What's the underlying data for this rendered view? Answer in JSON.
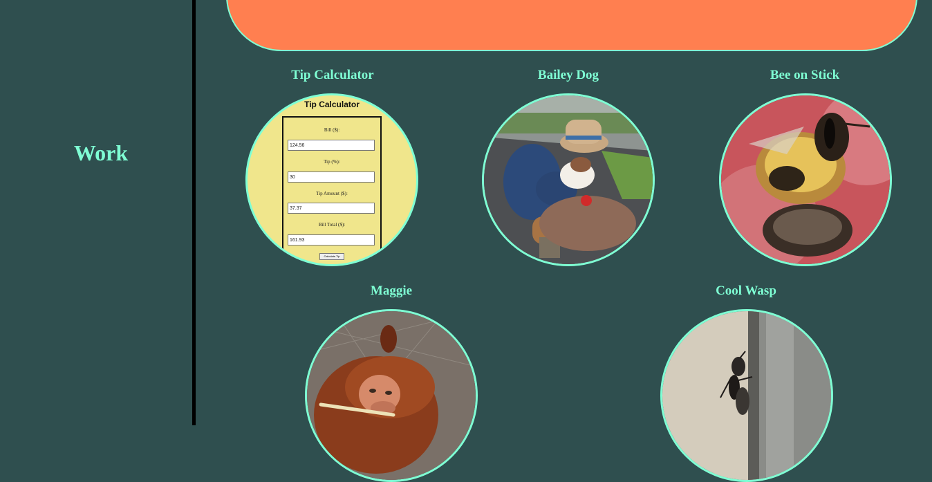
{
  "sidebar": {
    "title": "Work"
  },
  "colors": {
    "background": "#2f4f4f",
    "accent": "#7fffd4",
    "banner": "#ff7f50",
    "divider": "#000000"
  },
  "projects": [
    {
      "title": "Tip Calculator",
      "image": "tip-calculator-screenshot"
    },
    {
      "title": "Bailey Dog",
      "image": "person-hugging-dog-photo"
    },
    {
      "title": "Bee on Stick",
      "image": "bee-macro-photo"
    },
    {
      "title": "Maggie",
      "image": "orangutan-photo"
    },
    {
      "title": "Cool Wasp",
      "image": "wasp-on-post-photo"
    }
  ],
  "tip_calc": {
    "heading": "Tip Calculator",
    "bill_label": "Bill ($):",
    "bill_value": "124.56",
    "tip_label": "Tip (%):",
    "tip_value": "30",
    "amount_label": "Tip Amount ($):",
    "amount_value": "37.37",
    "total_label": "Bill Total ($):",
    "total_value": "161.93",
    "button": "Calculate Tip"
  }
}
